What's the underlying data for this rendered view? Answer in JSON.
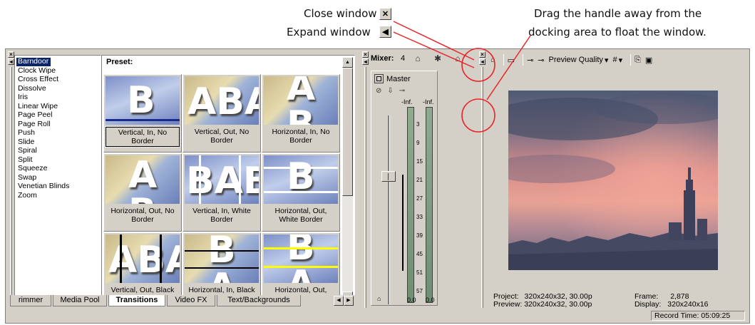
{
  "callouts": {
    "close_window": "Close window",
    "expand_window": "Expand window",
    "drag_line1": "Drag the handle away from the",
    "drag_line2": "docking area to float the window."
  },
  "transitions": {
    "items": [
      "Barndoor",
      "Clock Wipe",
      "Cross Effect",
      "Dissolve",
      "Iris",
      "Linear Wipe",
      "Page Peel",
      "Page Roll",
      "Push",
      "Slide",
      "Spiral",
      "Split",
      "Squeeze",
      "Swap",
      "Venetian Blinds",
      "Zoom"
    ],
    "selected_index": 0,
    "preset_label": "Preset:",
    "presets": [
      {
        "caption": "Vertical, In, No Border",
        "thumb_text": "B"
      },
      {
        "caption": "Vertical, Out, No Border",
        "thumb_text": "ABA"
      },
      {
        "caption": "Horizontal, In, No Border",
        "thumb_text": "A B"
      },
      {
        "caption": "Horizontal, Out, No Border",
        "thumb_text": "A B"
      },
      {
        "caption": "Vertical, In, White Border",
        "thumb_text": "BAB"
      },
      {
        "caption": "Horizontal, Out, White Border",
        "thumb_text": "B"
      },
      {
        "caption": "Vertical, Out, Black Border",
        "thumb_text": "ABA"
      },
      {
        "caption": "Horizontal, In, Black Border",
        "thumb_text": "B A"
      },
      {
        "caption": "Horizontal, Out, Yellow Border",
        "thumb_text": "B A B"
      }
    ]
  },
  "tabs": [
    "rimmer",
    "Media Pool",
    "Transitions",
    "Video FX",
    "Text/Backgrounds"
  ],
  "active_tab": "Transitions",
  "mixer": {
    "title": "Mixer:",
    "count": "4",
    "master_label": "Master",
    "inf_left": "-Inf.",
    "inf_right": "-Inf.",
    "scale": [
      "3",
      "9",
      "15",
      "21",
      "27",
      "33",
      "39",
      "45",
      "51",
      "57"
    ],
    "db_left": "0.0",
    "db_right": "0.0"
  },
  "preview": {
    "quality_label": "Preview Quality",
    "project_label": "Project:",
    "project_value": "320x240x32, 30.00p",
    "preview_label": "Preview:",
    "preview_value": "320x240x32, 30.00p",
    "frame_label": "Frame:",
    "frame_value": "2,878",
    "display_label": "Display:",
    "display_value": "320x240x16"
  },
  "status": {
    "record_time": "Record Time: 05:09:25"
  },
  "colors": {
    "accent_red": "#e8262a",
    "selection": "#0a246a",
    "face": "#d4d0c8"
  }
}
